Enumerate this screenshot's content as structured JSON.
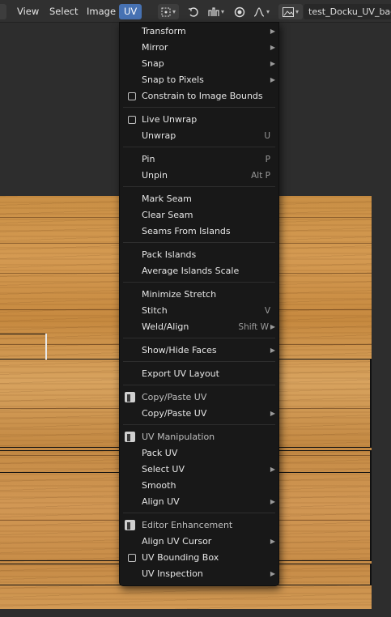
{
  "header": {
    "menus": [
      {
        "label": "View"
      },
      {
        "label": "Select"
      },
      {
        "label": "Image"
      },
      {
        "label": "UV"
      }
    ],
    "image_name": "test_Docku_UV_bac..."
  },
  "dropdown": {
    "groups": [
      [
        {
          "label": "Transform",
          "shortcut": "",
          "submenu": true,
          "check": false,
          "addon": false
        },
        {
          "label": "Mirror",
          "shortcut": "",
          "submenu": true,
          "check": false,
          "addon": false
        },
        {
          "label": "Snap",
          "shortcut": "",
          "submenu": true,
          "check": false,
          "addon": false
        },
        {
          "label": "Snap to Pixels",
          "shortcut": "",
          "submenu": true,
          "check": false,
          "addon": false
        },
        {
          "label": "Constrain to Image Bounds",
          "shortcut": "",
          "submenu": false,
          "check": true,
          "addon": false
        }
      ],
      [
        {
          "label": "Live Unwrap",
          "shortcut": "",
          "submenu": false,
          "check": true,
          "addon": false
        },
        {
          "label": "Unwrap",
          "shortcut": "U",
          "submenu": false,
          "check": false,
          "addon": false
        }
      ],
      [
        {
          "label": "Pin",
          "shortcut": "P",
          "submenu": false,
          "check": false,
          "addon": false
        },
        {
          "label": "Unpin",
          "shortcut": "Alt P",
          "submenu": false,
          "check": false,
          "addon": false
        }
      ],
      [
        {
          "label": "Mark Seam",
          "shortcut": "",
          "submenu": false,
          "check": false,
          "addon": false
        },
        {
          "label": "Clear Seam",
          "shortcut": "",
          "submenu": false,
          "check": false,
          "addon": false
        },
        {
          "label": "Seams From Islands",
          "shortcut": "",
          "submenu": false,
          "check": false,
          "addon": false
        }
      ],
      [
        {
          "label": "Pack Islands",
          "shortcut": "",
          "submenu": false,
          "check": false,
          "addon": false
        },
        {
          "label": "Average Islands Scale",
          "shortcut": "",
          "submenu": false,
          "check": false,
          "addon": false
        }
      ],
      [
        {
          "label": "Minimize Stretch",
          "shortcut": "",
          "submenu": false,
          "check": false,
          "addon": false
        },
        {
          "label": "Stitch",
          "shortcut": "V",
          "submenu": false,
          "check": false,
          "addon": false
        },
        {
          "label": "Weld/Align",
          "shortcut": "Shift W",
          "submenu": true,
          "check": false,
          "addon": false
        }
      ],
      [
        {
          "label": "Show/Hide Faces",
          "shortcut": "",
          "submenu": true,
          "check": false,
          "addon": false
        }
      ],
      [
        {
          "label": "Export UV Layout",
          "shortcut": "",
          "submenu": false,
          "check": false,
          "addon": false
        }
      ],
      [
        {
          "label": "Copy/Paste UV",
          "shortcut": "",
          "submenu": false,
          "check": false,
          "addon": true
        },
        {
          "label": "Copy/Paste UV",
          "shortcut": "",
          "submenu": true,
          "check": false,
          "addon": false
        }
      ],
      [
        {
          "label": "UV Manipulation",
          "shortcut": "",
          "submenu": false,
          "check": false,
          "addon": true
        },
        {
          "label": "Pack UV",
          "shortcut": "",
          "submenu": false,
          "check": false,
          "addon": false
        },
        {
          "label": "Select UV",
          "shortcut": "",
          "submenu": true,
          "check": false,
          "addon": false
        },
        {
          "label": "Smooth",
          "shortcut": "",
          "submenu": false,
          "check": false,
          "addon": false
        },
        {
          "label": "Align UV",
          "shortcut": "",
          "submenu": true,
          "check": false,
          "addon": false
        }
      ],
      [
        {
          "label": "Editor Enhancement",
          "shortcut": "",
          "submenu": false,
          "check": false,
          "addon": true
        },
        {
          "label": "Align UV Cursor",
          "shortcut": "",
          "submenu": true,
          "check": false,
          "addon": false
        },
        {
          "label": "UV Bounding Box",
          "shortcut": "",
          "submenu": false,
          "check": true,
          "addon": false
        },
        {
          "label": "UV Inspection",
          "shortcut": "",
          "submenu": true,
          "check": false,
          "addon": false
        }
      ]
    ]
  },
  "colors": {
    "accent": "#4772b3",
    "menu_bg": "#181818",
    "header_bg": "#303030"
  }
}
